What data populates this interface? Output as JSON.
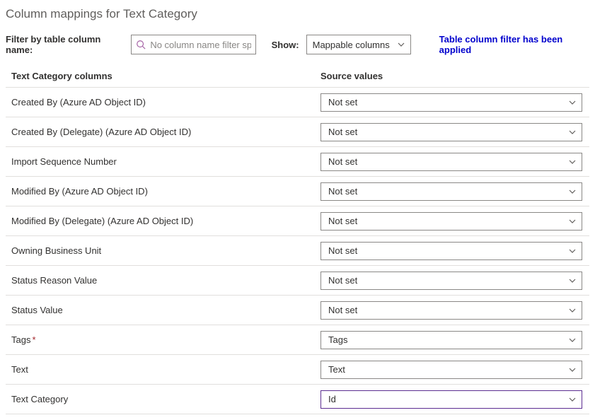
{
  "title": "Column mappings for Text Category",
  "filter": {
    "label": "Filter by table column name:",
    "placeholder": "No column name filter sp..."
  },
  "show": {
    "label": "Show:",
    "selected": "Mappable columns"
  },
  "applied_msg": "Table column filter has been applied",
  "table": {
    "col_a": "Text Category columns",
    "col_b": "Source values"
  },
  "rows": [
    {
      "label": "Created By (Azure AD Object ID)",
      "value": "Not set",
      "required": false,
      "highlight": false
    },
    {
      "label": "Created By (Delegate) (Azure AD Object ID)",
      "value": "Not set",
      "required": false,
      "highlight": false
    },
    {
      "label": "Import Sequence Number",
      "value": "Not set",
      "required": false,
      "highlight": false
    },
    {
      "label": "Modified By (Azure AD Object ID)",
      "value": "Not set",
      "required": false,
      "highlight": false
    },
    {
      "label": "Modified By (Delegate) (Azure AD Object ID)",
      "value": "Not set",
      "required": false,
      "highlight": false
    },
    {
      "label": "Owning Business Unit",
      "value": "Not set",
      "required": false,
      "highlight": false
    },
    {
      "label": "Status Reason Value",
      "value": "Not set",
      "required": false,
      "highlight": false
    },
    {
      "label": "Status Value",
      "value": "Not set",
      "required": false,
      "highlight": false
    },
    {
      "label": "Tags",
      "value": "Tags",
      "required": true,
      "highlight": false
    },
    {
      "label": "Text",
      "value": "Text",
      "required": false,
      "highlight": false
    },
    {
      "label": "Text Category",
      "value": "Id",
      "required": false,
      "highlight": true
    }
  ]
}
